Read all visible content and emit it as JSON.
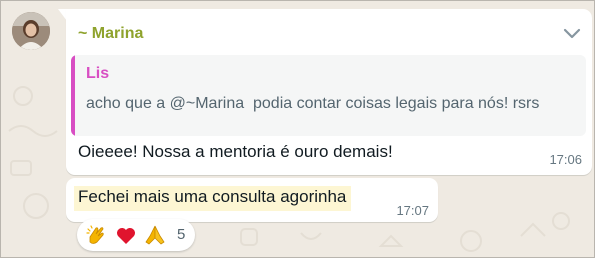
{
  "chat": {
    "message": {
      "sender": "~ Marina",
      "quote": {
        "author": "Lis",
        "text": "acho que a @~Marina  podia contar coisas legais para nós! rsrs"
      },
      "text": "Oieeee! Nossa a mentoria é ouro demais!",
      "time": "17:06"
    },
    "message2": {
      "text": "Fechei mais uma consulta agorinha",
      "time": "17:07"
    },
    "reactions": {
      "icons": [
        "clapping-hands-icon",
        "red-heart-icon",
        "folded-hands-icon"
      ],
      "count": "5"
    }
  },
  "colors": {
    "sender": "#8fa32d",
    "quote_accent": "#d84ec3",
    "background": "#efeae2",
    "highlight": "#fdf6d3"
  }
}
